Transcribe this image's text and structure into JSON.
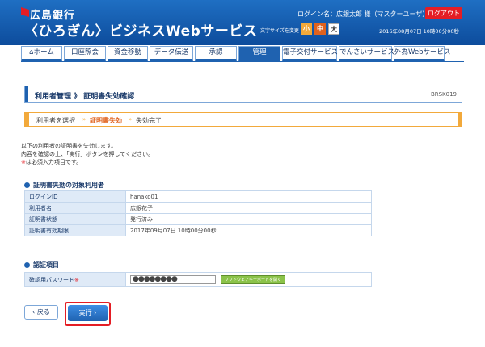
{
  "header": {
    "bank_name": "広島銀行",
    "service_name": "〈ひろぎん〉ビジネスWebサービス",
    "login_info": "ログイン名：広銀太郎 様（マスターユーザ）",
    "logout_label": "ログアウト",
    "font_size_label": "文字サイズを変更",
    "font_sizes": [
      "小",
      "中",
      "大"
    ],
    "datetime": "2016年08月07日 10時00分00秒",
    "colors": {
      "brand": "#1f62b0",
      "accent": "#e41d24",
      "orange": "#f2a93b"
    }
  },
  "nav": {
    "items": [
      {
        "label": "ホーム",
        "icon": "home-icon"
      },
      {
        "label": "口座照会"
      },
      {
        "label": "資金移動"
      },
      {
        "label": "データ伝送"
      },
      {
        "label": "承認"
      },
      {
        "label": "管理",
        "active": true
      },
      {
        "label": "電子交付サービス"
      },
      {
        "label": "でんさいサービス"
      },
      {
        "label": "外為Webサービス"
      }
    ]
  },
  "page": {
    "title": "利用者管理 》 証明書失効確認",
    "code": "BRSK019"
  },
  "steps": [
    {
      "label": "利用者を選択"
    },
    {
      "label": "証明書失効",
      "current": true
    },
    {
      "label": "失効完了"
    }
  ],
  "intro": {
    "line1": "以下の利用者の証明書を失効します。",
    "line2": "内容を確認の上、「実行」ボタンを押してください。",
    "line3_mark": "※",
    "line3_text": "は必須入力項目です。"
  },
  "target_section": {
    "title": "証明書失効の対象利用者",
    "rows": [
      {
        "label": "ログインID",
        "value": "hanako01"
      },
      {
        "label": "利用者名",
        "value": "広銀花子"
      },
      {
        "label": "証明書状態",
        "value": "発行済み"
      },
      {
        "label": "証明書有効期限",
        "value": "2017年09月07日 10時00分00秒"
      }
    ]
  },
  "auth_section": {
    "title": "認証項目",
    "password_label": "確認用パスワード",
    "required_mark": "※",
    "password_value": "●●●●●●●●",
    "keyboard_button": "ソフトウェアキーボードを開く"
  },
  "actions": {
    "back_label": "戻る",
    "execute_label": "実行"
  }
}
